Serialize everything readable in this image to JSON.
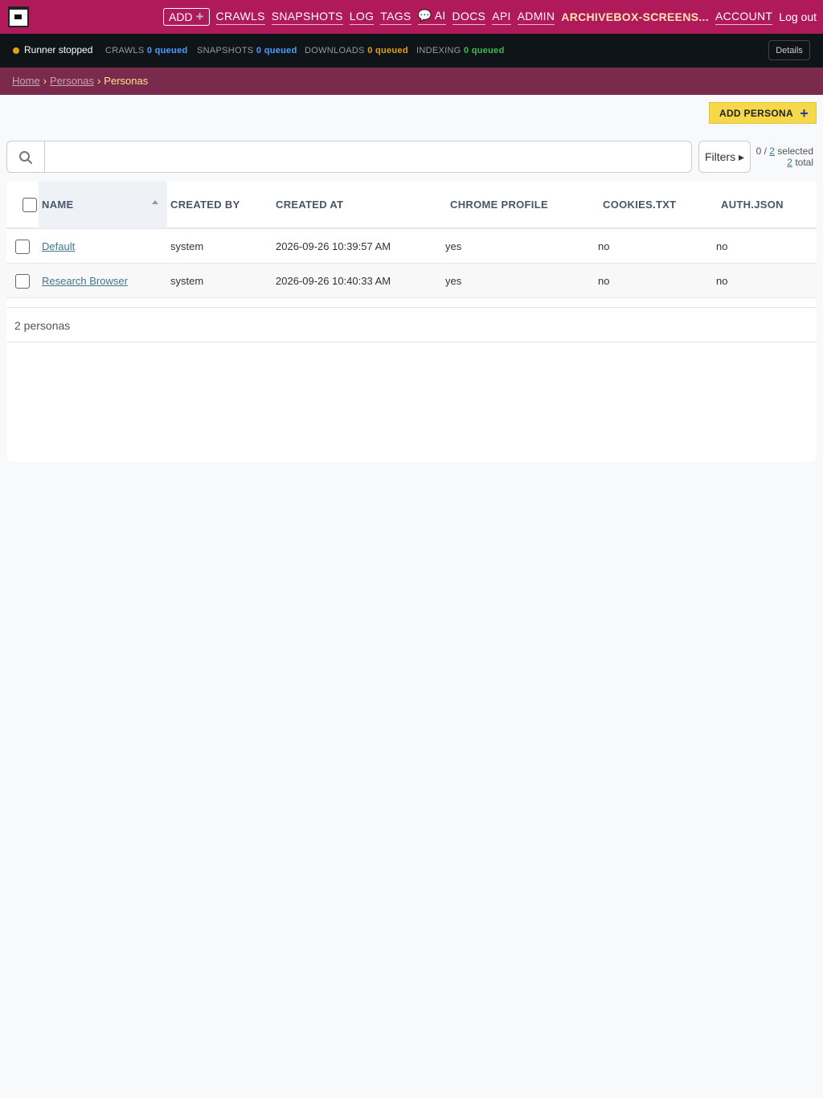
{
  "header": {
    "nav": {
      "add": "ADD",
      "crawls": "CRAWLS",
      "snapshots": "SNAPSHOTS",
      "log": "LOG",
      "tags": "TAGS",
      "ai": "💬 AI",
      "docs": "DOCS",
      "api": "API",
      "admin": "ADMIN",
      "user": "ARCHIVEBOX-SCREENS...",
      "account": "ACCOUNT",
      "logout": "Log out"
    }
  },
  "status": {
    "runner": "Runner stopped",
    "crawls_label": "CRAWLS",
    "crawls_value": "0 queued",
    "snapshots_label": "SNAPSHOTS",
    "snapshots_value": "0 queued",
    "downloads_label": "DOWNLOADS",
    "downloads_value": "0 queued",
    "indexing_label": "INDEXING",
    "indexing_value": "0 queued",
    "details": "Details",
    "colors": {
      "crawls": "#4a9eff",
      "snapshots": "#4a9eff",
      "downloads": "#e0a214",
      "indexing": "#3fb950"
    }
  },
  "breadcrumb": {
    "home": "Home",
    "parent": "Personas",
    "current": "Personas",
    "sep": "›"
  },
  "actions": {
    "add_persona": "ADD PERSONA"
  },
  "search": {
    "value": "",
    "placeholder": ""
  },
  "filters": "Filters ▸",
  "selection": {
    "selected": "0",
    "of": "2",
    "selected_word": "selected",
    "total": "2",
    "total_word": "total"
  },
  "table": {
    "columns": [
      "NAME",
      "CREATED BY",
      "CREATED AT",
      "CHROME PROFILE",
      "COOKIES.TXT",
      "AUTH.JSON"
    ],
    "rows": [
      [
        "Default",
        "system",
        "2026-09-26 10:39:57 AM",
        "yes",
        "no",
        "no"
      ],
      [
        "Research Browser",
        "system",
        "2026-09-26 10:40:33 AM",
        "yes",
        "no",
        "no"
      ]
    ],
    "footer": "2 personas"
  }
}
